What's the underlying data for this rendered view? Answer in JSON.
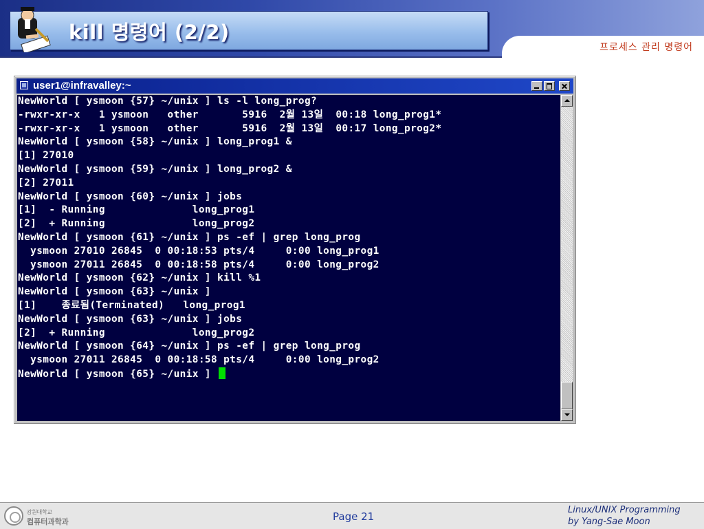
{
  "slide": {
    "title": "kill 명령어 (2/2)",
    "subtitle": "프로세스 관리 명령어"
  },
  "terminal": {
    "window_title": "user1@infravalley:~",
    "lines": [
      "NewWorld [ ysmoon {57} ~/unix ] ls -l long_prog?",
      "-rwxr-xr-x   1 ysmoon   other       5916  2월 13일  00:18 long_prog1*",
      "-rwxr-xr-x   1 ysmoon   other       5916  2월 13일  00:17 long_prog2*",
      "NewWorld [ ysmoon {58} ~/unix ] long_prog1 &",
      "[1] 27010",
      "NewWorld [ ysmoon {59} ~/unix ] long_prog2 &",
      "[2] 27011",
      "NewWorld [ ysmoon {60} ~/unix ] jobs",
      "[1]  - Running              long_prog1",
      "[2]  + Running              long_prog2",
      "NewWorld [ ysmoon {61} ~/unix ] ps -ef | grep long_prog",
      "  ysmoon 27010 26845  0 00:18:53 pts/4     0:00 long_prog1",
      "  ysmoon 27011 26845  0 00:18:58 pts/4     0:00 long_prog2",
      "NewWorld [ ysmoon {62} ~/unix ] kill %1",
      "NewWorld [ ysmoon {63} ~/unix ]",
      "[1]    종료됨(Terminated)   long_prog1",
      "NewWorld [ ysmoon {63} ~/unix ] jobs",
      "[2]  + Running              long_prog2",
      "NewWorld [ ysmoon {64} ~/unix ] ps -ef | grep long_prog",
      "  ysmoon 27011 26845  0 00:18:58 pts/4     0:00 long_prog2",
      "NewWorld [ ysmoon {65} ~/unix ] "
    ]
  },
  "footer": {
    "university_small": "강원대학교",
    "department": "컴퓨터과학과",
    "page": "Page 21",
    "credit_line1": "Linux/UNIX Programming",
    "credit_line2": "by Yang-Sae Moon"
  },
  "colors": {
    "terminal_bg": "#000040",
    "cursor": "#00e000",
    "subtitle": "#c0391b"
  }
}
